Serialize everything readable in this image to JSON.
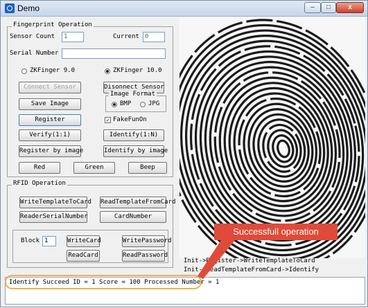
{
  "window": {
    "title": "Demo",
    "minimize_glyph": "–",
    "maximize_glyph": "□",
    "close_glyph": "x"
  },
  "fingerprint": {
    "legend": "Fingerprint Operation",
    "sensor_count_label": "Sensor Count",
    "sensor_count_value": "1",
    "current_label": "Current",
    "current_value": "0",
    "serial_label": "Serial Number",
    "serial_value": "",
    "zk9_label": "ZKFinger 9.0",
    "zk10_label": "ZKFinger 10.0",
    "connect_label": "Connect Sensor",
    "disconnect_label": "Disonnect Sensor",
    "format_legend": "Image Format",
    "bmp_label": "BMP",
    "jpg_label": "JPG",
    "save_image_label": "Save Image",
    "register_label": "Register",
    "fakefun_label": "FakeFunOn",
    "verify_label": "Verify(1:1)",
    "identify_label": "Identify(1:N)",
    "register_by_image_label": "Register by image",
    "identify_by_image_label": "Identify by image",
    "red_label": "Red",
    "green_label": "Green",
    "beep_label": "Beep"
  },
  "rfid": {
    "legend": "RFID Operation",
    "write_template_label": "WriteTemplateToCard",
    "read_template_label": "ReadTemplateFromCard",
    "reader_serial_label": "ReaderSerialNumber",
    "card_number_label": "CardNumber",
    "block_label": "Block",
    "block_value": "1",
    "write_card_label": "WriteCard",
    "write_password_label": "WritePassword",
    "read_card_label": "ReadCard",
    "read_password_label": "ReadPassword"
  },
  "log": [
    "Init->Register->WriteTemplateToCard",
    "Init->ReadTemplateFromCard->Identify"
  ],
  "status": "Identify Succeed ID = 1 Score = 100  Processed Number = 1",
  "annotation": {
    "callout": "Successfull operation",
    "callout_color": "#e04a3a",
    "highlight_color": "#e8b254"
  }
}
